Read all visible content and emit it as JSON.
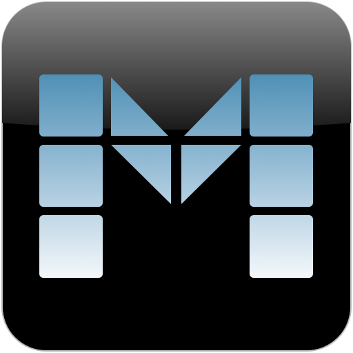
{
  "icon": {
    "name": "m-logo-icon",
    "letter": "M",
    "colors": {
      "background": "#ffffff",
      "tile_dark": "#000000",
      "gloss_top": "#8a8a8a",
      "gloss_bottom": "#1a1a1a",
      "tile_border": "#bdbdbd",
      "letter_top": "#5090b6",
      "letter_mid": "#8fb8d2",
      "letter_bottom": "#f4f8fb"
    }
  }
}
